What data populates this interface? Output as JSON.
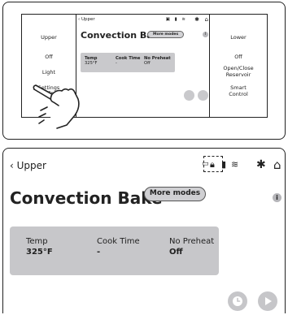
{
  "panel": {
    "left_buttons": [
      {
        "label": "Upper"
      },
      {
        "label": "Off"
      },
      {
        "label": "Light"
      },
      {
        "label": "Settings",
        "sub": "◎3s"
      }
    ],
    "right_buttons": [
      {
        "label": "Lower"
      },
      {
        "label": "Off"
      },
      {
        "label": "Open/Close Reservoir"
      },
      {
        "label": "Smart Control"
      }
    ],
    "mini_screen": {
      "back": "‹ Upper",
      "title": "Convection Bake",
      "more_modes": "More modes",
      "info": "i",
      "temp_label": "Temp",
      "temp_value": "325°F",
      "cook_label": "Cook Time",
      "cook_value": "-",
      "preheat_label": "No Preheat",
      "preheat_value": "Off"
    }
  },
  "screen": {
    "back": "‹ Upper",
    "title": "Convection Bake",
    "more_modes": "More modes",
    "info": "i",
    "status": {
      "temp_label": "Temp",
      "temp_value": "325°F",
      "cook_label": "Cook Time",
      "cook_value": "-",
      "preheat_label": "No Preheat",
      "preheat_value": "Off"
    },
    "icons": [
      "lock-icon",
      "remote-icon",
      "wifi-icon",
      "gear-icon",
      "home-icon",
      "clock-icon",
      "play-icon"
    ]
  },
  "colors": {
    "card": "#c7c7ca",
    "button_gray": "#cfcfd2",
    "text": "#222222"
  }
}
